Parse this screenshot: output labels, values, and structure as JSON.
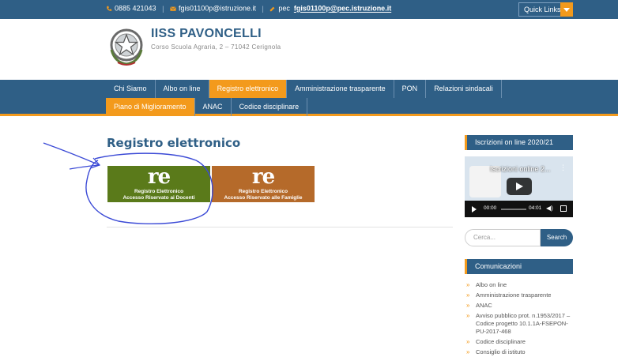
{
  "topbar": {
    "phone": "0885 421043",
    "email": "fgis01100p@istruzione.it",
    "pec_label": "pec",
    "pec_email": "fgis01100p@pec.istruzione.it",
    "quick_links": "Quick Links"
  },
  "header": {
    "title": "IISS PAVONCELLI",
    "subtitle": "Corso Scuola Agraria, 2 – 71042 Cerignola"
  },
  "nav": {
    "row1": [
      "Chi Siamo",
      "Albo on line",
      "Registro elettronico",
      "Amministrazione trasparente",
      "PON",
      "Relazioni sindacali"
    ],
    "row2": [
      "Piano di Miglioramento",
      "ANAC",
      "Codice disciplinare"
    ],
    "active_row1": "Registro elettronico",
    "active_row2": "Piano di Miglioramento"
  },
  "main": {
    "page_title": "Registro elettronico",
    "banners": [
      {
        "logo": "re",
        "line1": "Registro Elettronico",
        "line2": "Accesso Riservato ai Docenti"
      },
      {
        "logo": "re",
        "line1": "Registro Elettronico",
        "line2": "Accesso Riservato alle Famiglie"
      }
    ]
  },
  "sidebar": {
    "video_heading": "Iscrizioni on line 2020/21",
    "video_title": "Iscrizioni online 2...",
    "video_time_current": "00:00",
    "video_time_total": "04:01",
    "search_placeholder": "Cerca...",
    "search_button": "Search",
    "comms_heading": "Comunicazioni",
    "links": [
      "Albo on line",
      "Amministrazione trasparente",
      "ANAC",
      "Avviso pubblico prot. n.1953/2017 – Codice progetto 10.1.1A-FSEPON-PU-2017-468",
      "Codice disciplinare",
      "Consiglio di istituto"
    ]
  },
  "colors": {
    "primary": "#2f5f86",
    "accent": "#f39a1c",
    "banner_docenti": "#5a7a1a",
    "banner_famiglie": "#b56a2a",
    "annotation_ink": "#3b4ad6"
  },
  "icons": [
    "phone-icon",
    "mail-icon",
    "pec-icon",
    "chevron-down-icon",
    "emblem-logo",
    "play-icon",
    "volume-icon",
    "fullscreen-icon",
    "bullet-chevron-icon"
  ]
}
